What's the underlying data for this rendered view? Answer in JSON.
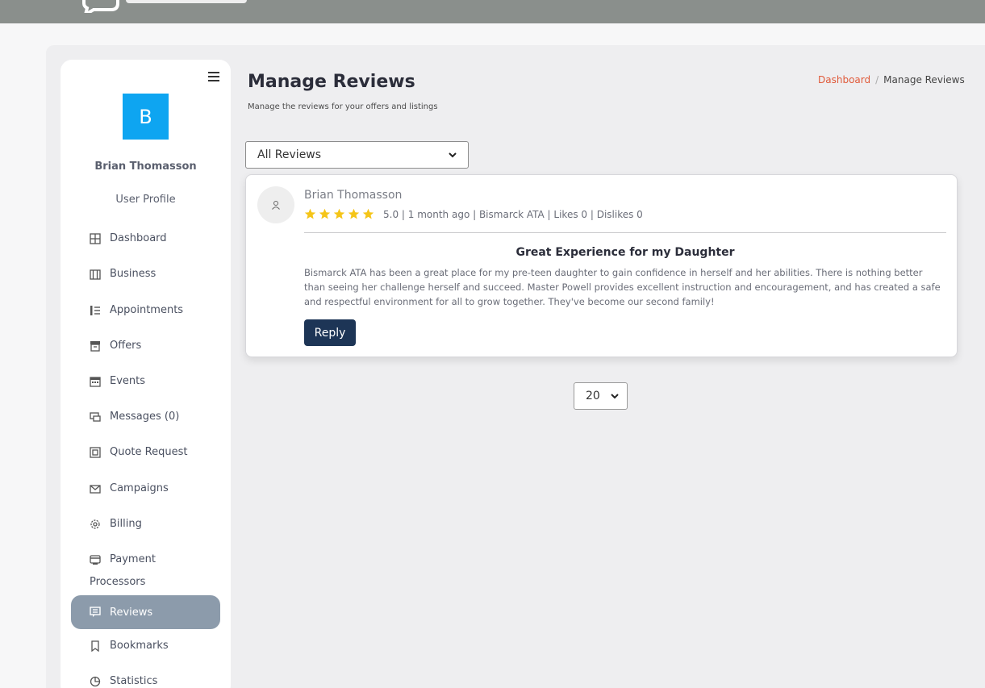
{
  "sidebar": {
    "avatar_letter": "B",
    "user_name": "Brian Thomasson",
    "user_profile_label": "User Profile",
    "items": [
      {
        "label": "Dashboard",
        "icon": "grid-icon"
      },
      {
        "label": "Business",
        "icon": "building-icon"
      },
      {
        "label": "Appointments",
        "icon": "list-icon"
      },
      {
        "label": "Offers",
        "icon": "archive-icon"
      },
      {
        "label": "Events",
        "icon": "calendar-icon"
      },
      {
        "label": "Messages (0)",
        "icon": "chat-icon"
      },
      {
        "label": "Quote Request",
        "icon": "quote-icon"
      },
      {
        "label": "Campaigns",
        "icon": "envelope-icon"
      },
      {
        "label": "Billing",
        "icon": "gear-icon"
      },
      {
        "label": "Payment",
        "label_line2": "Processors",
        "icon": "card-icon"
      },
      {
        "label": "Reviews",
        "icon": "review-icon",
        "active": true
      },
      {
        "label": "Bookmarks",
        "icon": "bookmark-icon"
      },
      {
        "label": "Statistics",
        "icon": "pie-icon"
      }
    ]
  },
  "header": {
    "title": "Manage Reviews",
    "subtitle": "Manage the reviews for your offers and listings"
  },
  "breadcrumb": {
    "home": "Dashboard",
    "separator": "/",
    "current": "Manage Reviews"
  },
  "filter": {
    "selected": "All Reviews"
  },
  "review": {
    "reviewer": "Brian Thomasson",
    "rating": 5,
    "meta": "5.0 | 1 month ago | Bismarck ATA | Likes 0 | Dislikes 0",
    "title": "Great Experience for my Daughter",
    "body": "Bismarck ATA has been a great place for my pre-teen daughter to gain confidence in herself and her abilities. There is nothing better than seeing her challenge herself and succeed. Master Powell provides excellent instruction and encouragement, and has created a safe and respectful environment for all to grow together. They've become our second family!",
    "reply_label": "Reply"
  },
  "pagination": {
    "page_size": "20"
  },
  "colors": {
    "accent": "#0ea5f1",
    "nav_active": "#8c9bab",
    "reply_button": "#1d3556",
    "star": "#f5c518",
    "breadcrumb_link": "#e05a3a"
  }
}
